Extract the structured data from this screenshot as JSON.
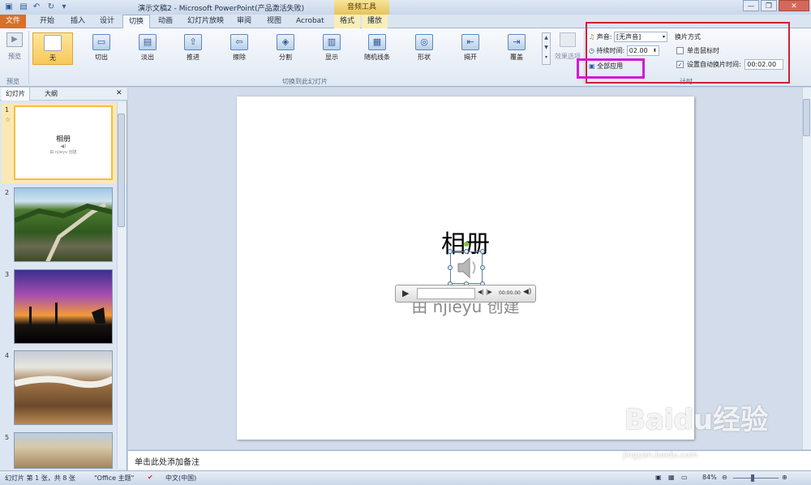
{
  "titlebar": {
    "title": "演示文稿2 - Microsoft PowerPoint(产品激活失败)",
    "context_group": "音频工具",
    "minimize": "—",
    "restore": "❐",
    "close": "✕"
  },
  "tabs": [
    "文件",
    "开始",
    "插入",
    "设计",
    "切换",
    "动画",
    "幻灯片放映",
    "审阅",
    "视图",
    "Acrobat",
    "格式",
    "播放"
  ],
  "ribbon": {
    "preview_label": "预览",
    "preview_group": "预览",
    "transitions_group": "切换到此幻灯片",
    "transitions": [
      {
        "label": "无",
        "icon": "none-icon"
      },
      {
        "label": "切出",
        "icon": "cut-icon"
      },
      {
        "label": "淡出",
        "icon": "fade-icon"
      },
      {
        "label": "推进",
        "icon": "push-icon"
      },
      {
        "label": "擦除",
        "icon": "wipe-icon"
      },
      {
        "label": "分割",
        "icon": "split-icon"
      },
      {
        "label": "显示",
        "icon": "reveal-icon"
      },
      {
        "label": "随机线条",
        "icon": "random-bars-icon"
      },
      {
        "label": "形状",
        "icon": "shape-icon"
      },
      {
        "label": "揭开",
        "icon": "uncover-icon"
      },
      {
        "label": "覆盖",
        "icon": "cover-icon"
      }
    ],
    "effect_options": "效果选项",
    "sound_label": "声音:",
    "sound_value": "[无声音]",
    "duration_label": "持续时间:",
    "duration_value": "02.00",
    "apply_all": "全部应用",
    "advance_title": "换片方式",
    "on_click": "单击鼠标时",
    "auto_after": "设置自动换片时间:",
    "auto_value": "00:02.00",
    "timing_group": "计时"
  },
  "left_pane": {
    "tabs": [
      "幻灯片",
      "大纲"
    ],
    "close": "✕",
    "slides": [
      {
        "num": "1",
        "title": "相册",
        "sub": "由 njieyu 创建"
      },
      {
        "num": "2"
      },
      {
        "num": "3"
      },
      {
        "num": "4"
      },
      {
        "num": "5"
      }
    ]
  },
  "slide": {
    "title": "相册",
    "subtitle": "由 njieyu 创建",
    "player_time": "00:00.00"
  },
  "notes_placeholder": "单击此处添加备注",
  "statusbar": {
    "slide_info": "幻灯片 第 1 张，共 8 张",
    "theme": "\"Office 主题\"",
    "language": "中文(中国)",
    "zoom": "84%"
  },
  "watermark": {
    "brand": "Baidu经验",
    "url": "jingyan.baidu.com"
  }
}
